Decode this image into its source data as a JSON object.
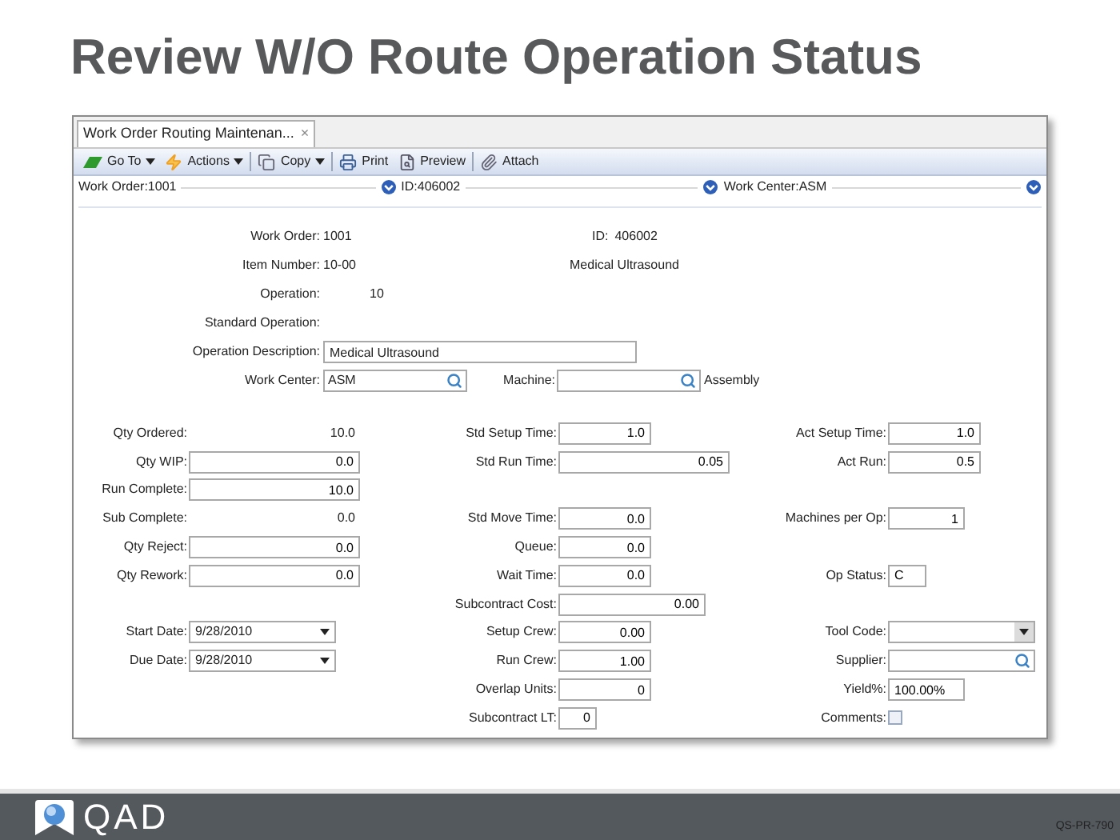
{
  "title": "Review W/O Route Operation Status",
  "tab": {
    "label": "Work Order Routing Maintenan...",
    "close": "×"
  },
  "toolbar": [
    {
      "kind": "goto",
      "label": "Go To",
      "dropdown": true,
      "separator_after": false
    },
    {
      "kind": "actions",
      "label": "Actions",
      "dropdown": true,
      "separator_after": true
    },
    {
      "kind": "copy",
      "label": "Copy",
      "dropdown": true,
      "separator_after": true
    },
    {
      "kind": "print",
      "label": "Print",
      "dropdown": false,
      "separator_after": false
    },
    {
      "kind": "preview",
      "label": "Preview",
      "dropdown": false,
      "separator_after": true
    },
    {
      "kind": "attach",
      "label": "Attach",
      "dropdown": false,
      "separator_after": false
    }
  ],
  "navigation": [
    {
      "label": "Work Order:1001"
    },
    {
      "label": "ID:406002"
    },
    {
      "label": "Work Center:ASM"
    }
  ],
  "header": {
    "work_order": {
      "label": "Work Order:",
      "value": "1001"
    },
    "id": {
      "label": "ID:",
      "value": "406002"
    },
    "item_number": {
      "label": "Item Number:",
      "value": "10-00"
    },
    "item_description": "Medical Ultrasound",
    "operation": {
      "label": "Operation:",
      "value": "10"
    },
    "standard_operation": {
      "label": "Standard Operation:"
    },
    "operation_description": {
      "label": "Operation Description:",
      "value": "Medical Ultrasound"
    },
    "work_center": {
      "label": "Work Center:",
      "value": "ASM"
    },
    "machine": {
      "label": "Machine:"
    },
    "machine_description": "Assembly"
  },
  "rows": [
    {
      "cells": [
        {
          "kind": "plain",
          "label": "Qty Ordered:",
          "value": "10.0"
        },
        {
          "kind": "shortinput",
          "label": "Std Setup Time:",
          "value": "1.0"
        },
        {
          "kind": "shortinput",
          "label": "Act Setup Time:",
          "value": "1.0"
        }
      ]
    },
    {
      "cells": [
        {
          "kind": "longinput",
          "label": "Qty WIP:",
          "value": "0.0"
        },
        {
          "kind": "longinput",
          "label": "Std Run Time:",
          "value": "0.05"
        },
        {
          "kind": "shortinput",
          "label": "Act Run:",
          "value": "0.5"
        }
      ]
    },
    {
      "cells": [
        {
          "kind": "longinput",
          "label": "Run Complete:",
          "value": "10.0"
        },
        {
          "kind": "empty"
        },
        {
          "kind": "empty"
        }
      ]
    },
    {
      "cells": [
        {
          "kind": "plain",
          "label": "Sub Complete:",
          "value": "0.0"
        },
        {
          "kind": "shortinput",
          "label": "Std Move Time:",
          "value": "0.0"
        },
        {
          "kind": "smallinput",
          "label": "Machines per Op:",
          "value": "1"
        }
      ]
    },
    {
      "cells": [
        {
          "kind": "longinput",
          "label": "Qty Reject:",
          "value": "0.0"
        },
        {
          "kind": "shortinput",
          "label": "Queue:",
          "value": "0.0"
        },
        {
          "kind": "empty"
        }
      ]
    },
    {
      "cells": [
        {
          "kind": "longinput",
          "label": "Qty Rework:",
          "value": "0.0"
        },
        {
          "kind": "shortinput",
          "label": "Wait Time:",
          "value": "0.0"
        },
        {
          "kind": "tinytext",
          "label": "Op Status:",
          "value": "C"
        }
      ]
    },
    {
      "cells": [
        {
          "kind": "empty"
        },
        {
          "kind": "mediuminput",
          "label": "Subcontract Cost:",
          "value": "0.00"
        },
        {
          "kind": "empty"
        }
      ]
    },
    {
      "cells": [
        {
          "kind": "date",
          "label": "Start Date:",
          "value": "9/28/2010"
        },
        {
          "kind": "shortinput",
          "label": "Setup Crew:",
          "value": "0.00"
        },
        {
          "kind": "combo",
          "label": "Tool Code:"
        }
      ]
    },
    {
      "cells": [
        {
          "kind": "date",
          "label": "Due Date:",
          "value": "9/28/2010"
        },
        {
          "kind": "shortinput",
          "label": "Run Crew:",
          "value": "1.00"
        },
        {
          "kind": "lookup",
          "label": "Supplier:"
        }
      ]
    },
    {
      "cells": [
        {
          "kind": "empty"
        },
        {
          "kind": "shortinput",
          "label": "Overlap Units:",
          "value": "0"
        },
        {
          "kind": "smalltext",
          "label": "Yield%:",
          "value": "100.00%"
        }
      ]
    },
    {
      "cells": [
        {
          "kind": "empty"
        },
        {
          "kind": "tinyinput",
          "label": "Subcontract LT:",
          "value": "0"
        },
        {
          "kind": "checkbox",
          "label": "Comments:",
          "checked": false
        }
      ]
    }
  ],
  "footer": {
    "brand": "QAD",
    "code": "QS-PR-790"
  }
}
